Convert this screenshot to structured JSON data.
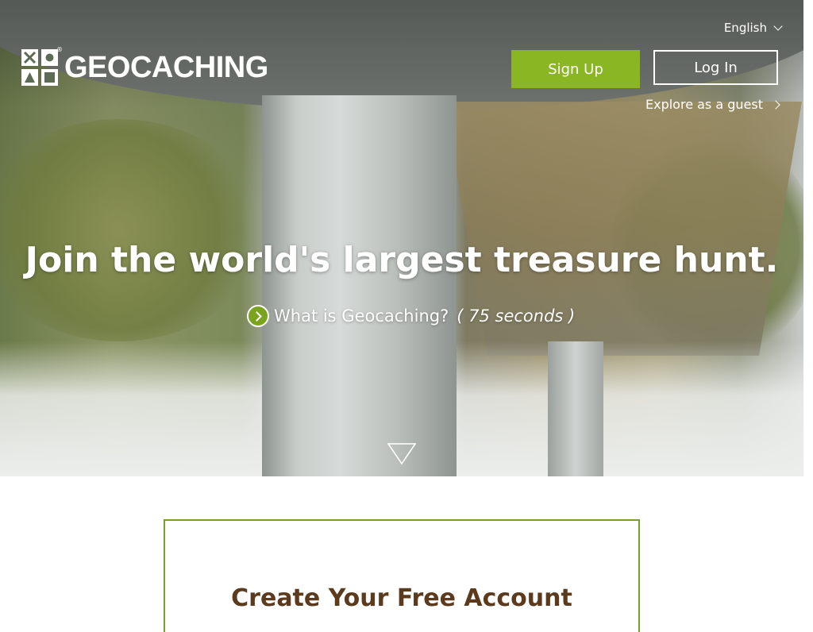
{
  "header": {
    "logo_text": "GEOCACHING",
    "language": "English",
    "signup_label": "Sign Up",
    "login_label": "Log In",
    "guest_label": "Explore as a guest"
  },
  "hero": {
    "headline": "Join the world's largest treasure hunt.",
    "video_link_label": "What is Geocaching?",
    "video_duration": "( 75 seconds )"
  },
  "signup": {
    "title": "Create Your Free Account"
  },
  "colors": {
    "brand_green": "#8ab623",
    "brand_brown": "#5b3a1d",
    "box_border": "#7a9f2a"
  },
  "icons": [
    "logo-mark-icon",
    "chevron-down-icon",
    "chevron-right-icon",
    "play-icon",
    "scroll-down-icon"
  ]
}
